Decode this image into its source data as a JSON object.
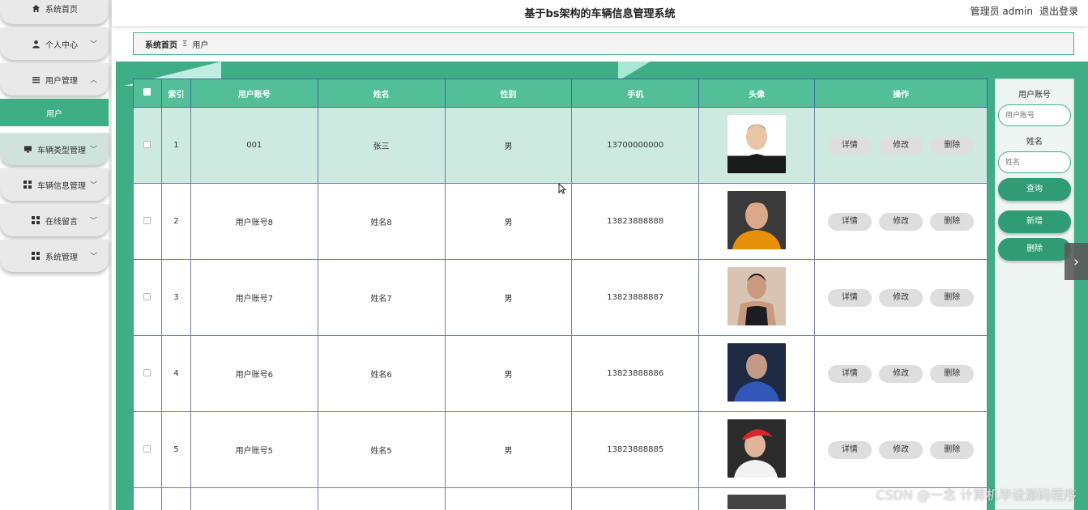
{
  "header": {
    "title": "基于bs架构的车辆信息管理系统",
    "user_label": "管理员 admin",
    "logout": "退出登录"
  },
  "sidebar": {
    "items": [
      {
        "label": "系统首页",
        "icon": "home-icon"
      },
      {
        "label": "个人中心",
        "icon": "user-icon"
      },
      {
        "label": "用户管理",
        "icon": "list-icon"
      },
      {
        "label": "用户",
        "icon": ""
      },
      {
        "label": "车辆类型管理",
        "icon": "monitor-icon"
      },
      {
        "label": "车辆信息管理",
        "icon": "grid-icon"
      },
      {
        "label": "在线留言",
        "icon": "grid-icon"
      },
      {
        "label": "系统管理",
        "icon": "grid-icon"
      }
    ]
  },
  "breadcrumb": {
    "home": "系统首页",
    "separator": "Ξ",
    "current": "用户"
  },
  "table": {
    "columns": [
      "索引",
      "用户账号",
      "姓名",
      "性别",
      "手机",
      "头像",
      "操作"
    ],
    "rows": [
      {
        "index": "1",
        "account": "001",
        "name": "张三",
        "gender": "男",
        "phone": "13700000000"
      },
      {
        "index": "2",
        "account": "用户账号8",
        "name": "姓名8",
        "gender": "男",
        "phone": "13823888888"
      },
      {
        "index": "3",
        "account": "用户账号7",
        "name": "姓名7",
        "gender": "男",
        "phone": "13823888887"
      },
      {
        "index": "4",
        "account": "用户账号6",
        "name": "姓名6",
        "gender": "男",
        "phone": "13823888886"
      },
      {
        "index": "5",
        "account": "用户账号5",
        "name": "姓名5",
        "gender": "男",
        "phone": "13823888885"
      }
    ],
    "actions": {
      "detail": "详情",
      "edit": "修改",
      "delete": "删除"
    }
  },
  "search": {
    "account_label": "用户账号",
    "account_placeholder": "用户账号",
    "name_label": "姓名",
    "name_placeholder": "姓名",
    "query": "查询",
    "add": "新增",
    "delete": "删除"
  },
  "colors": {
    "accent": "#3fae86",
    "header_row": "#52bf98",
    "highlight_row": "#cde9e0"
  },
  "watermark": "CSDN @一念 计算机毕设源码程序"
}
